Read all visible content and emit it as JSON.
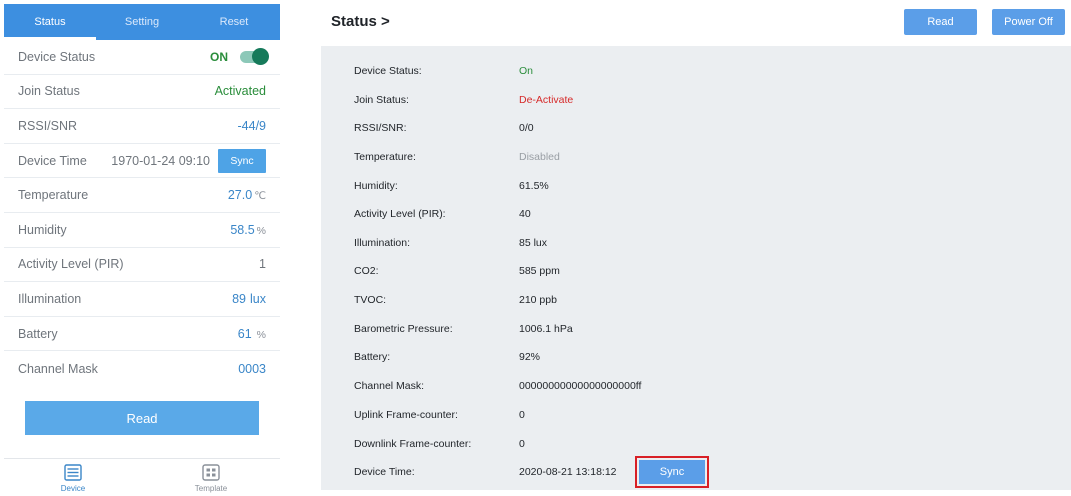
{
  "mobile": {
    "tabs": [
      {
        "label": "Status",
        "active": true
      },
      {
        "label": "Setting",
        "active": false
      },
      {
        "label": "Reset",
        "active": false
      }
    ],
    "device_status": {
      "label": "Device Status",
      "value": "ON",
      "toggle_on": true
    },
    "join_status": {
      "label": "Join Status",
      "value": "Activated"
    },
    "rssi": {
      "label": "RSSI/SNR",
      "value": "-44/9"
    },
    "device_time": {
      "label": "Device Time",
      "value": "1970-01-24 09:10",
      "sync_label": "Sync"
    },
    "temperature": {
      "label": "Temperature",
      "value": "27.0",
      "unit": "℃"
    },
    "humidity": {
      "label": "Humidity",
      "value": "58.5",
      "unit": "%"
    },
    "activity": {
      "label": "Activity Level (PIR)",
      "value": "1"
    },
    "illumination": {
      "label": "Illumination",
      "value": "89",
      "unit": "lux"
    },
    "battery": {
      "label": "Battery",
      "value": "61",
      "unit": "%"
    },
    "channel_mask": {
      "label": "Channel Mask",
      "value": "0003"
    },
    "read_label": "Read",
    "nav": [
      {
        "label": "Device",
        "icon": "device-list-icon",
        "active": true
      },
      {
        "label": "Template",
        "icon": "template-grid-icon",
        "active": false
      }
    ]
  },
  "web": {
    "title": "Status >",
    "read_label": "Read",
    "power_off_label": "Power Off",
    "rows": [
      {
        "label": "Device Status:",
        "value": "On",
        "style": "green"
      },
      {
        "label": "Join Status:",
        "value": "De-Activate",
        "style": "red"
      },
      {
        "label": "RSSI/SNR:",
        "value": "0/0",
        "style": ""
      },
      {
        "label": "Temperature:",
        "value": "Disabled",
        "style": "grey"
      },
      {
        "label": "Humidity:",
        "value": "61.5%",
        "style": ""
      },
      {
        "label": "Activity Level (PIR):",
        "value": "40",
        "style": ""
      },
      {
        "label": "Illumination:",
        "value": "85 lux",
        "style": ""
      },
      {
        "label": "CO2:",
        "value": "585 ppm",
        "style": ""
      },
      {
        "label": "TVOC:",
        "value": "210 ppb",
        "style": ""
      },
      {
        "label": "Barometric Pressure:",
        "value": "1006.1 hPa",
        "style": ""
      },
      {
        "label": "Battery:",
        "value": "92%",
        "style": ""
      },
      {
        "label": "Channel Mask:",
        "value": "00000000000000000000ff",
        "style": ""
      },
      {
        "label": "Uplink Frame-counter:",
        "value": "0",
        "style": ""
      },
      {
        "label": "Downlink Frame-counter:",
        "value": "0",
        "style": ""
      },
      {
        "label": "Device Time:",
        "value": "2020-08-21 13:18:12",
        "style": ""
      }
    ],
    "sync_label": "Sync"
  },
  "colors": {
    "accent": "#3d8fe0",
    "button": "#5b9ee8",
    "active_green": "#2a8d3b",
    "inactive_red": "#d62a2a",
    "highlight": "#d81f26"
  }
}
